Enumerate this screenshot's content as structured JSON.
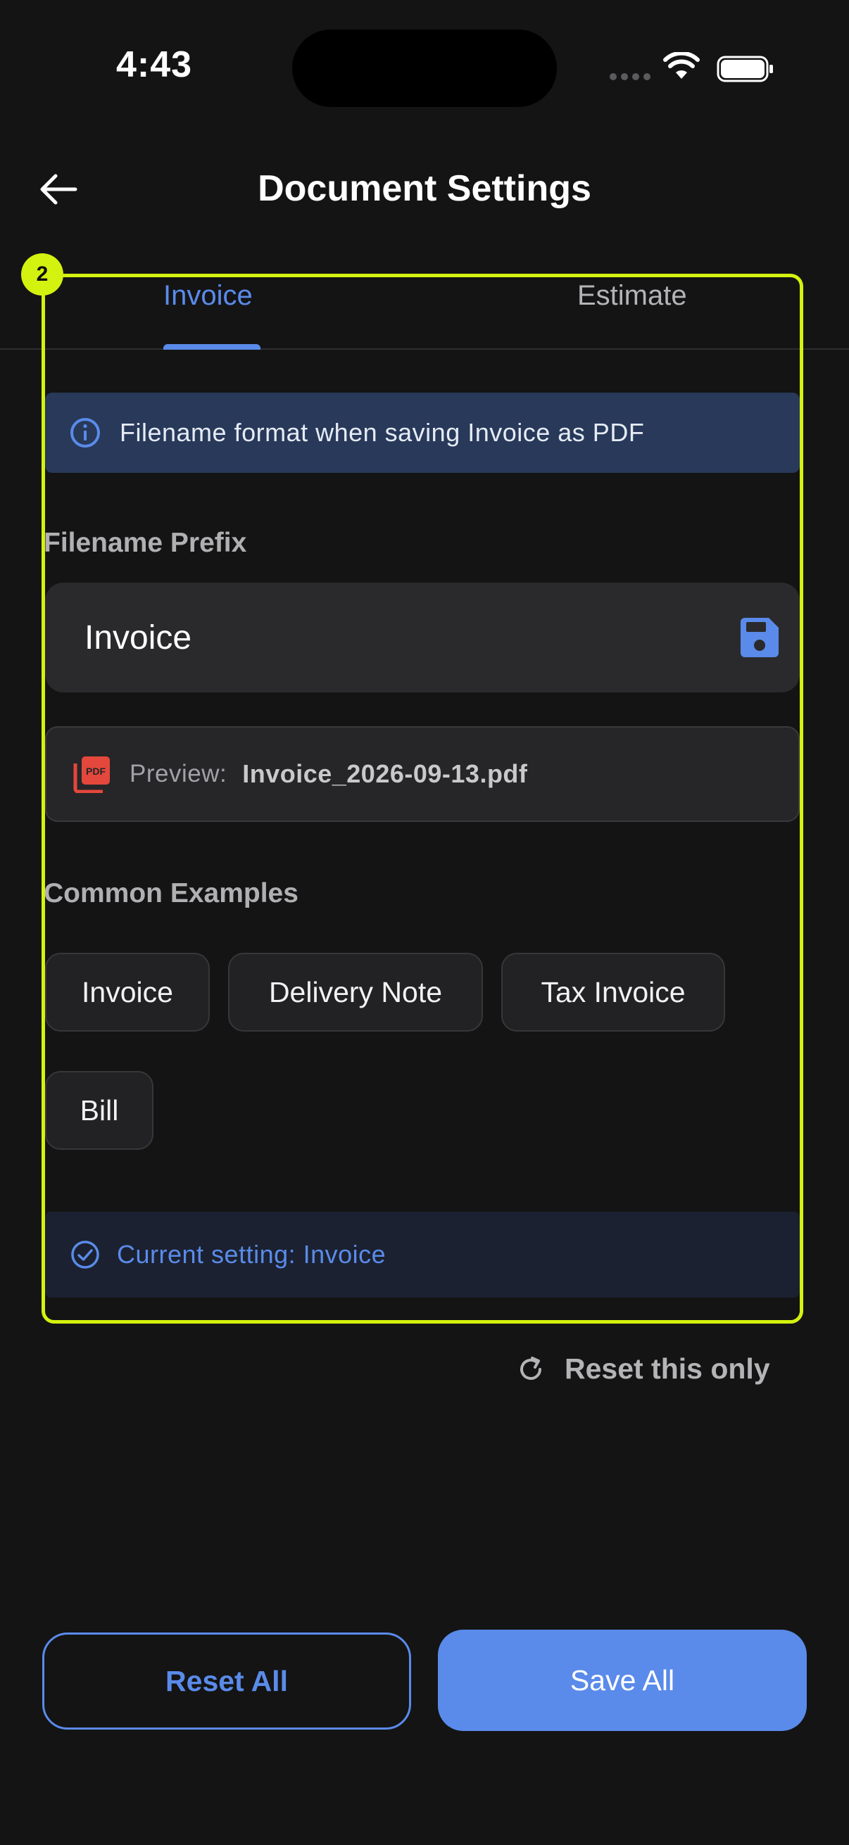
{
  "status_bar": {
    "time": "4:43",
    "icons": [
      "signal-dots-icon",
      "wifi-icon",
      "battery-icon"
    ]
  },
  "header": {
    "title": "Document Settings",
    "back_icon": "arrow-left-icon"
  },
  "tabs": [
    {
      "label": "Invoice",
      "active": true
    },
    {
      "label": "Estimate",
      "active": false
    }
  ],
  "info_banner": {
    "icon": "info-circle-icon",
    "text": "Filename format when saving Invoice as PDF"
  },
  "prefix": {
    "label": "Filename Prefix",
    "value": "Invoice",
    "save_icon": "floppy-disk-icon"
  },
  "preview": {
    "icon": "pdf-file-icon",
    "label": "Preview:",
    "value": "Invoice_2026-09-13.pdf"
  },
  "examples": {
    "label": "Common Examples",
    "chips": [
      "Invoice",
      "Delivery Note",
      "Tax Invoice",
      "Bill"
    ]
  },
  "current_setting": {
    "icon": "check-circle-icon",
    "text": "Current setting: Invoice"
  },
  "reset_this_only": {
    "icon": "refresh-icon",
    "label": "Reset this only"
  },
  "footer": {
    "reset_all": "Reset All",
    "save_all": "Save All"
  },
  "highlight": {
    "badge": "2"
  },
  "colors": {
    "background": "#141415",
    "accent": "#5a8bea",
    "highlight": "#d4f20f",
    "pdf_red": "#e4473c"
  }
}
